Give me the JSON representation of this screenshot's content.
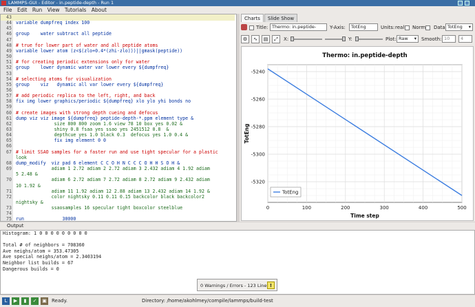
{
  "window": {
    "title": "LAMMPS-GUI - Editor - in.peptide-depth - Run 1"
  },
  "menu": [
    "File",
    "Edit",
    "Run",
    "View",
    "Tutorials",
    "About"
  ],
  "editor": {
    "lines": [
      {
        "n": "43",
        "code": ""
      },
      {
        "n": "44",
        "code": "variable dumpfreq index 100"
      },
      {
        "n": "45",
        "code": ""
      },
      {
        "n": "46",
        "code": "group    water subtract all peptide"
      },
      {
        "n": "47",
        "code": ""
      },
      {
        "n": "48",
        "code": "# true for lower part of water and all peptide atoms"
      },
      {
        "n": "49",
        "code": "variable lower atom (z<$(zlo+0.4*(zhi-zlo)))||gmask(peptide))"
      },
      {
        "n": "50",
        "code": ""
      },
      {
        "n": "51",
        "code": "# for creating periodic extensions only for water"
      },
      {
        "n": "52",
        "code": "group    lower dynamic water var lower every ${dumpfreq}"
      },
      {
        "n": "53",
        "code": ""
      },
      {
        "n": "54",
        "code": "# selecting atoms for visualization"
      },
      {
        "n": "55",
        "code": "group    viz   dynamic all var lower every ${dumpfreq}"
      },
      {
        "n": "56",
        "code": ""
      },
      {
        "n": "57",
        "code": "# add periodic replica to the left, right, and back"
      },
      {
        "n": "58",
        "code": "fix img lower graphics/periodic ${dumpfreq} xlo ylo yhi bonds no"
      },
      {
        "n": "59",
        "code": ""
      },
      {
        "n": "60",
        "code": "# create images with strong depth cueing and defocus"
      },
      {
        "n": "61",
        "code": "dump viz viz image ${dumpfreq} peptide-depth-*.ppm element type &"
      },
      {
        "n": "62",
        "code": "              size 800 800 zoom 1.6 view 78 10 box yes 0.02 &"
      },
      {
        "n": "63",
        "code": "              shiny 0.8 fsaa yes ssao yes 2451512 0.8  &"
      },
      {
        "n": "64",
        "code": "              depthcue yes 1.0 black 0.3  defocus yes 1.0 0.4 &"
      },
      {
        "n": "65",
        "code": "              fix img element 0 0"
      },
      {
        "n": "66",
        "code": ""
      },
      {
        "n": "67",
        "code": "# limit SSAO samples for a faster run and use tight specular for a plastic"
      },
      {
        "n": "",
        "code": "look"
      },
      {
        "n": "68",
        "code": "dump_modify  viz pad 6 element C C O H N C C C O H H S O H &"
      },
      {
        "n": "69",
        "code": "             adiam 1 2.72 adiam 2 2.72 adiam 3 2.432 adiam 4 1.92 adiam"
      },
      {
        "n": "",
        "code": "5 2.48 &"
      },
      {
        "n": "70",
        "code": "             adiam 6 2.72 adiam 7 2.72 adiam 8 2.72 adiam 9 2.432 adiam"
      },
      {
        "n": "",
        "code": "10 1.92 &"
      },
      {
        "n": "71",
        "code": "             adiam 11 1.92 adiam 12 2.88 adiam 13 2.432 adiam 14 1.92 &"
      },
      {
        "n": "72",
        "code": "             color nightsky 0.11 0.11 0.15 backcolor black backcolor2"
      },
      {
        "n": "",
        "code": "nightsky &"
      },
      {
        "n": "73",
        "code": "             ssaosamples 16 specular tight boxcolor steelblue"
      },
      {
        "n": "74",
        "code": ""
      },
      {
        "n": "75",
        "code": "run              30000"
      },
      {
        "n": "76",
        "code": ""
      }
    ]
  },
  "charts": {
    "tabs": [
      "Charts",
      "Slide Show"
    ],
    "title_label": "Title:",
    "title_value": "Thermo: in.peptide-depth",
    "yaxis_label": "Y-Axis:",
    "yaxis_value": "TotEng",
    "units_label": "Units:",
    "units_value": "real",
    "norm_label": "Norm:",
    "data_label": "Data:",
    "data_value": "TotEng",
    "x_label": "X:",
    "y_label": "Y:",
    "plot_label": "Plot:",
    "plot_value": "Raw",
    "smooth_label": "Smooth:",
    "smooth_a": "10",
    "smooth_b": "4"
  },
  "chart_data": {
    "type": "line",
    "title": "Thermo: in.peptide-depth",
    "xlabel": "Time step",
    "ylabel": "TotEng",
    "xlim": [
      0,
      500
    ],
    "ylim": [
      -5335,
      -5235
    ],
    "xticks": [
      0,
      100,
      200,
      300,
      400,
      500
    ],
    "yticks": [
      -5240,
      -5260,
      -5280,
      -5300,
      -5320
    ],
    "grid": true,
    "legend": "bottom-left",
    "series": [
      {
        "name": "TotEng",
        "color": "#3d7ee0",
        "x": [
          0,
          500
        ],
        "y": [
          -5238,
          -5330
        ]
      }
    ]
  },
  "output": {
    "label": "Output",
    "lines": [
      "Histogram: 1 0 0 0 0 0 0 0 0 0",
      "",
      "Total # of neighbors = 708360",
      "Ave neighs/atom = 353.47305",
      "Ave special neighs/atom = 2.3403194",
      "Neighbor list builds = 67",
      "Dangerous builds = 0"
    ]
  },
  "warnings": {
    "text": "0 Warnings / Errors - 123 Lines"
  },
  "status": {
    "ready": "Ready.",
    "directory": "Directory: /home/akohlmey/compile/lammps/build-test"
  }
}
